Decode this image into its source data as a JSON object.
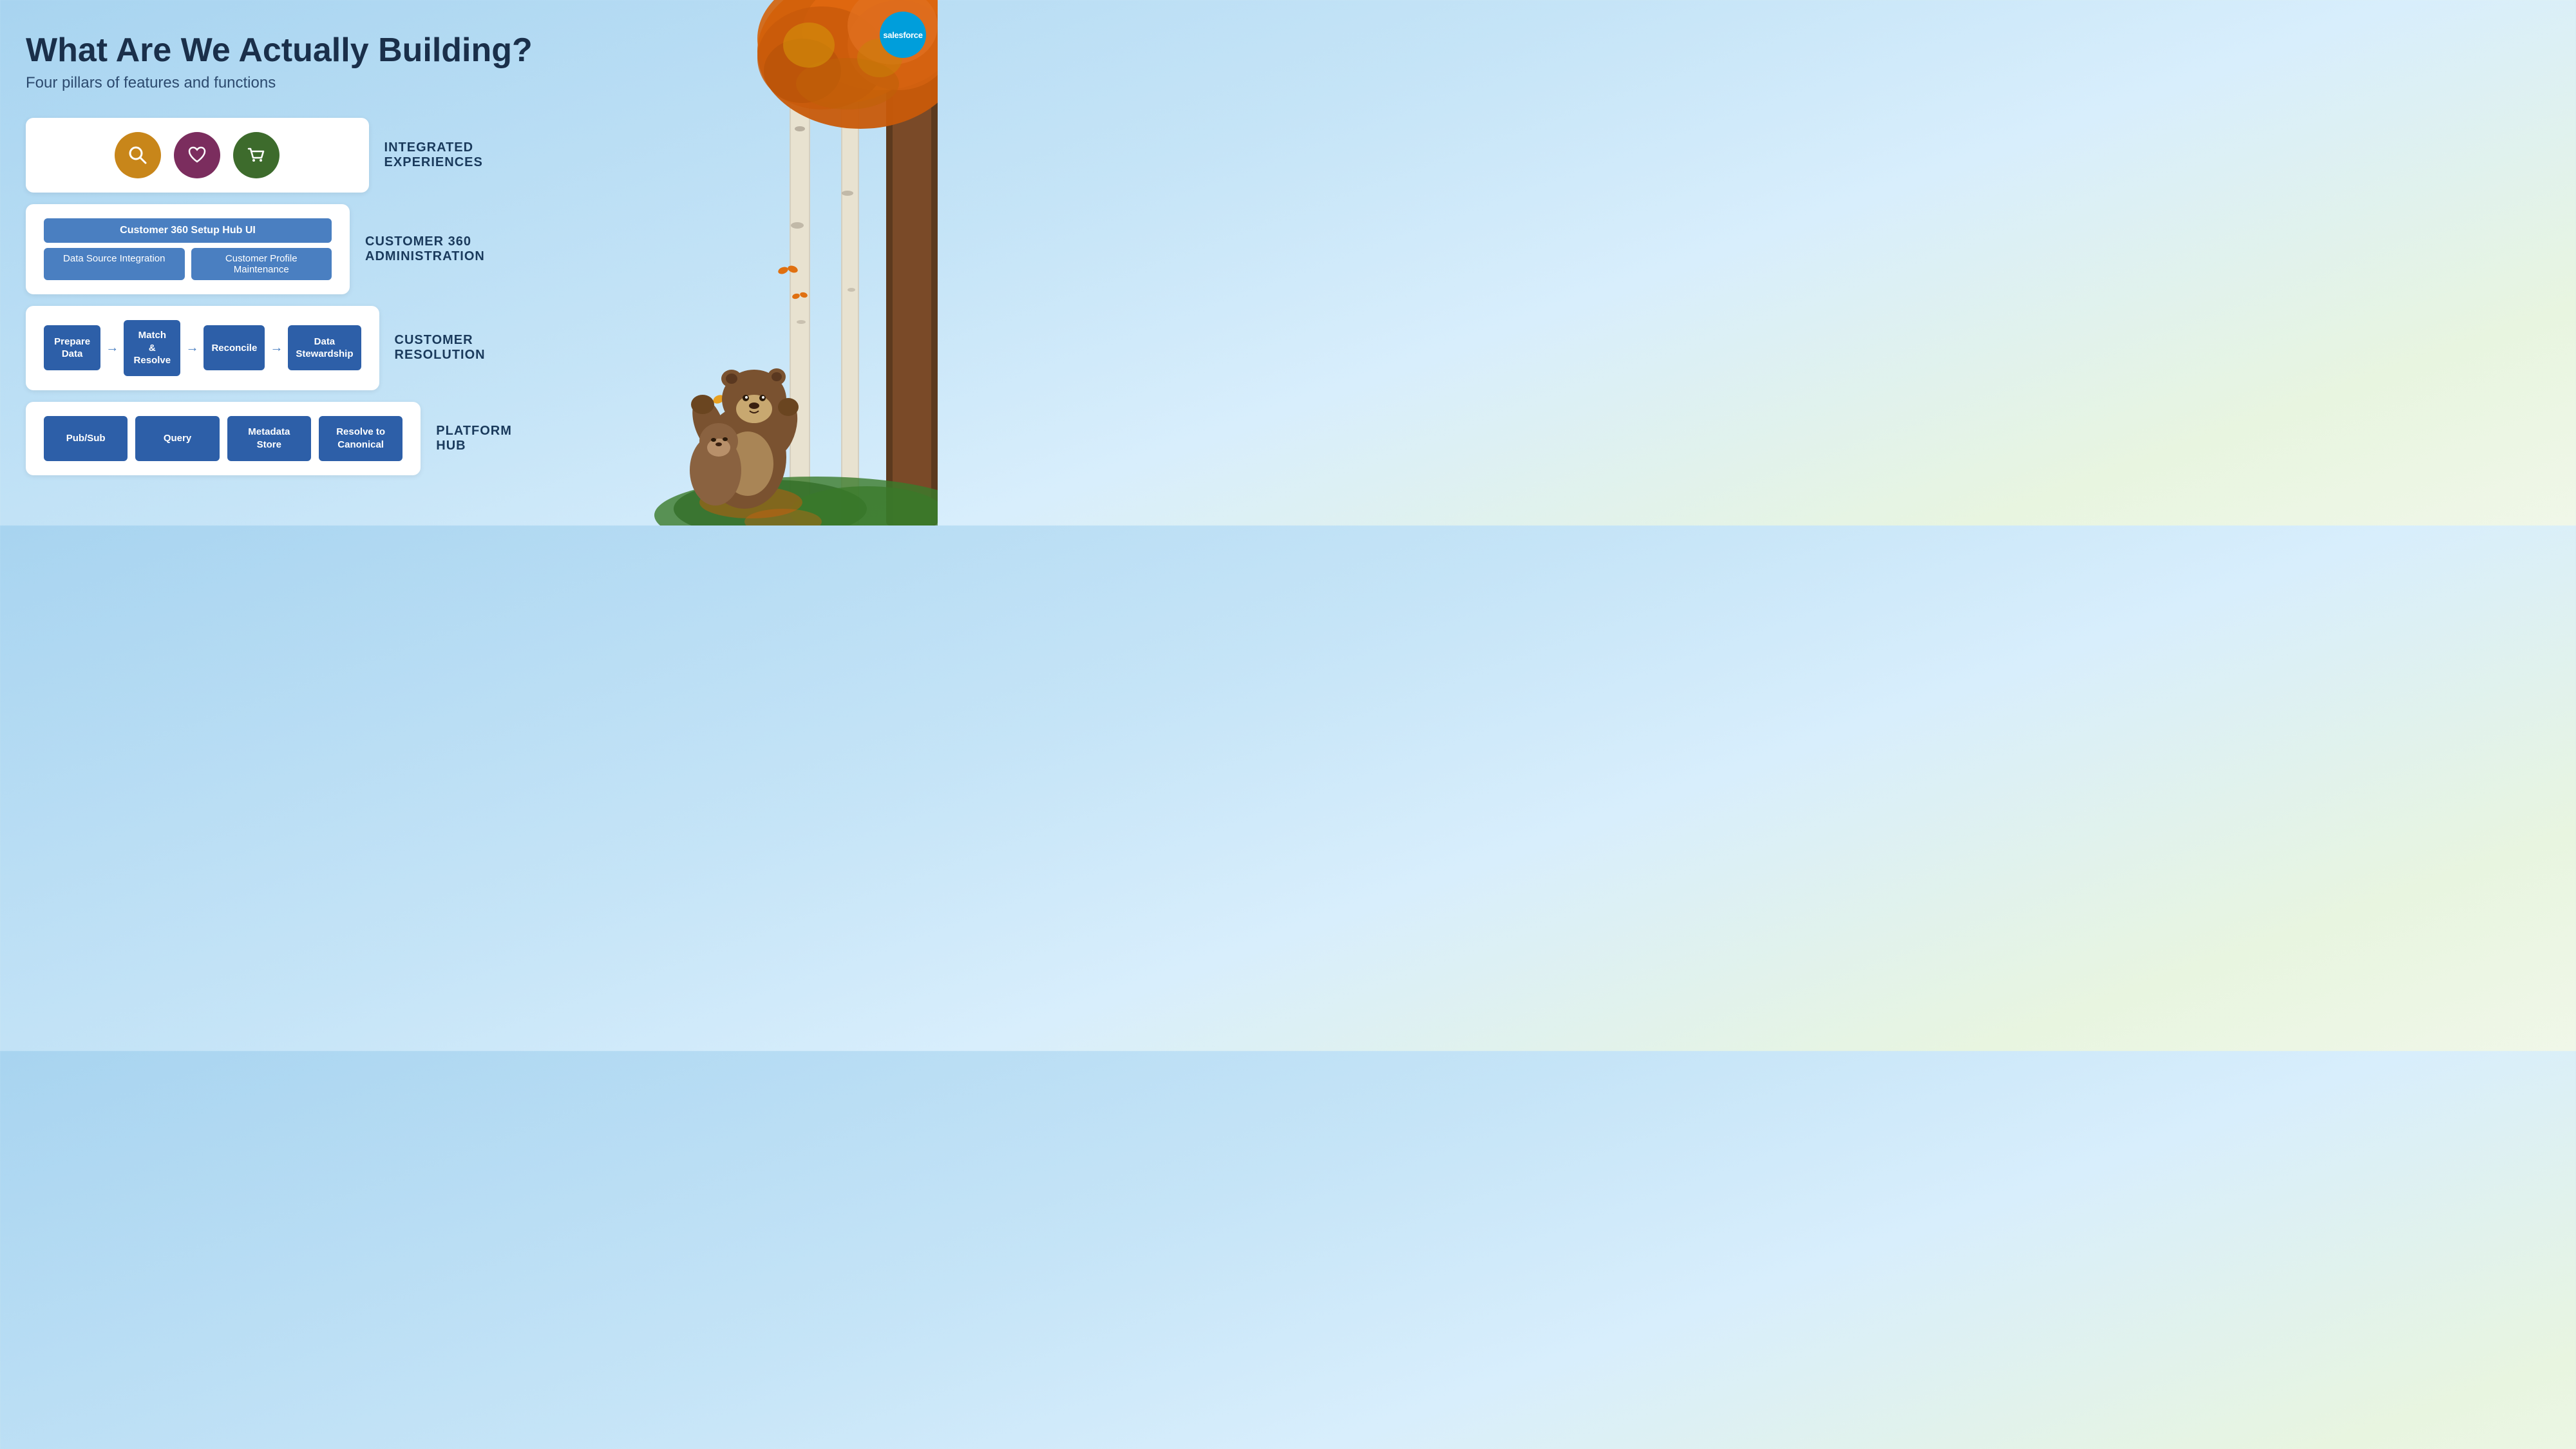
{
  "header": {
    "title": "What Are We Actually Building?",
    "subtitle": "Four pillars of features and functions"
  },
  "logo": {
    "label": "salesforce"
  },
  "pillars": [
    {
      "id": "integrated-experiences",
      "label": "INTEGRATED EXPERIENCES",
      "type": "icons",
      "icons": [
        {
          "name": "search",
          "symbol": "🔍",
          "color_class": "icon-search"
        },
        {
          "name": "heart",
          "symbol": "♡",
          "color_class": "icon-heart"
        },
        {
          "name": "cart",
          "symbol": "🛒",
          "color_class": "icon-cart"
        }
      ]
    },
    {
      "id": "customer-360-admin",
      "label": "CUSTOMER 360 ADMINISTRATION",
      "type": "admin",
      "top_bar": "Customer 360 Setup Hub UI",
      "bottom_items": [
        "Data Source Integration",
        "Customer Profile Maintenance"
      ]
    },
    {
      "id": "customer-resolution",
      "label": "CUSTOMER RESOLUTION",
      "type": "flow",
      "steps": [
        "Prepare Data",
        "Match\n& Resolve",
        "Reconcile",
        "Data\nStewardship"
      ]
    },
    {
      "id": "platform-hub",
      "label": "PLATFORM HUB",
      "type": "platform",
      "items": [
        "Pub/Sub",
        "Query",
        "Metadata\nStore",
        "Resolve to\nCanonical"
      ]
    }
  ]
}
